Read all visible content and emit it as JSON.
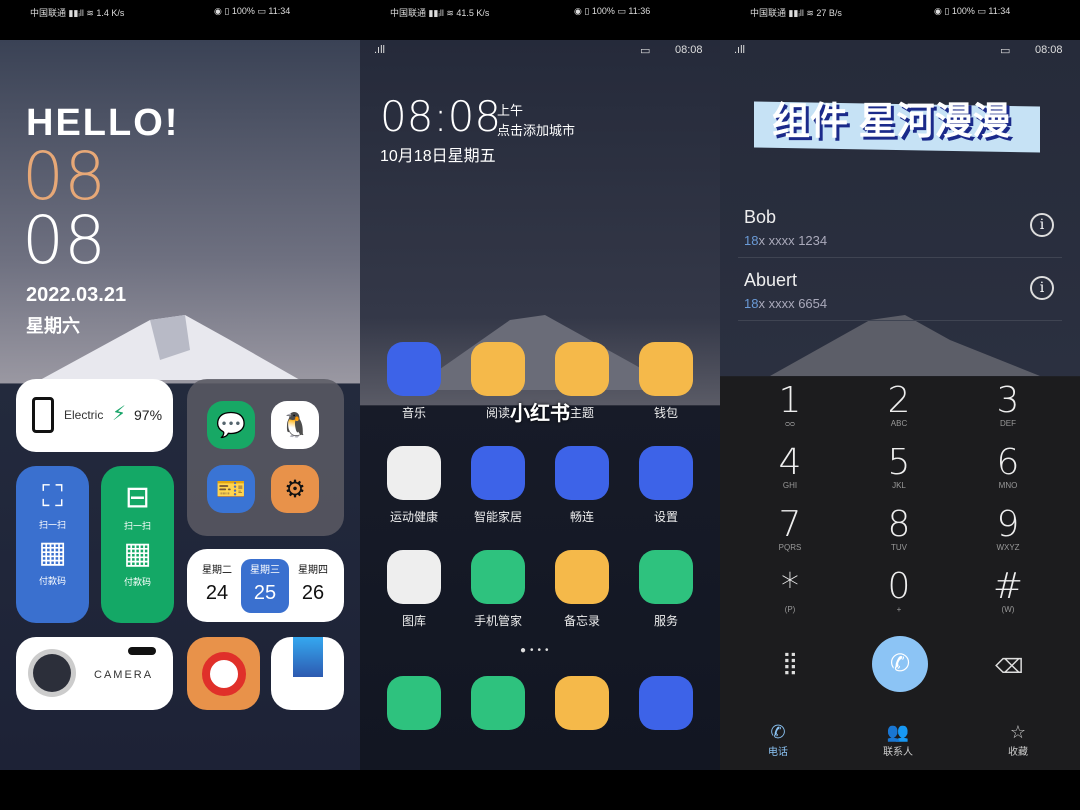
{
  "status_bars": [
    {
      "carrier": "中国联通",
      "speed": "1.4 K/s",
      "battery": "100%",
      "time": "11:34"
    },
    {
      "carrier": "中国联通",
      "speed": "41.5 K/s",
      "battery": "100%",
      "time": "11:36"
    },
    {
      "carrier": "中国联通",
      "speed": "27 B/s",
      "battery": "100%",
      "time": "11:34"
    }
  ],
  "left": {
    "hello": "HELLO!",
    "hour": "08",
    "minute": "08",
    "date": "2022.03.21",
    "weekday": "星期六",
    "battery_widget": {
      "label": "Electric",
      "percent": "97%",
      "level": 97
    },
    "scan_blue": {
      "scan": "扫一扫",
      "pay": "付款码"
    },
    "scan_green": {
      "scan": "扫一扫",
      "pay": "付款码"
    },
    "calendar": [
      {
        "day": "星期二",
        "num": "24"
      },
      {
        "day": "星期三",
        "num": "25"
      },
      {
        "day": "星期四",
        "num": "26"
      }
    ],
    "camera_label": "CAMERA"
  },
  "middle": {
    "phone_time": "08:08",
    "clock": "08:08",
    "ampm": "上午",
    "city_hint": "点击添加城市",
    "date": "10月18日星期五",
    "watermark": "小红书",
    "apps": [
      {
        "label": "音乐",
        "icon": "piano-icon",
        "color": "#3d63e8"
      },
      {
        "label": "阅读",
        "icon": "books-icon",
        "color": "#f5b94a"
      },
      {
        "label": "主题",
        "icon": "paintbrush-icon",
        "color": "#f5b94a"
      },
      {
        "label": "钱包",
        "icon": "wallet-icon",
        "color": "#f5b94a"
      },
      {
        "label": "运动健康",
        "icon": "heart-icon",
        "color": "#eeeeee"
      },
      {
        "label": "智能家居",
        "icon": "speaker-icon",
        "color": "#3d63e8"
      },
      {
        "label": "畅连",
        "icon": "webcam-icon",
        "color": "#3d63e8"
      },
      {
        "label": "设置",
        "icon": "gear-icon",
        "color": "#3d63e8"
      },
      {
        "label": "图库",
        "icon": "gallery-icon",
        "color": "#eeeeee"
      },
      {
        "label": "手机管家",
        "icon": "shield-icon",
        "color": "#2ec27e"
      },
      {
        "label": "备忘录",
        "icon": "notes-icon",
        "color": "#f5b94a"
      },
      {
        "label": "服务",
        "icon": "service-icon",
        "color": "#2ec27e"
      }
    ],
    "dock": [
      {
        "icon": "phone-icon",
        "color": "#2ec27e"
      },
      {
        "icon": "message-icon",
        "color": "#2ec27e"
      },
      {
        "icon": "browser-icon",
        "color": "#f5b94a"
      },
      {
        "icon": "camera-icon",
        "color": "#3d63e8"
      }
    ]
  },
  "right": {
    "phone_time": "08:08",
    "banner": "组件 星河漫漫",
    "contacts": [
      {
        "name": "Bob",
        "prefix": "18",
        "number": "x xxxx 1234"
      },
      {
        "name": "Abuert",
        "prefix": "18",
        "number": "x xxxx 6654"
      }
    ],
    "keys": [
      {
        "d": "1",
        "s": "ᴑᴑ"
      },
      {
        "d": "2",
        "s": "ABC"
      },
      {
        "d": "3",
        "s": "DEF"
      },
      {
        "d": "4",
        "s": "GHI"
      },
      {
        "d": "5",
        "s": "JKL"
      },
      {
        "d": "6",
        "s": "MNO"
      },
      {
        "d": "7",
        "s": "PQRS"
      },
      {
        "d": "8",
        "s": "TUV"
      },
      {
        "d": "9",
        "s": "WXYZ"
      },
      {
        "d": "*",
        "s": "(P)"
      },
      {
        "d": "0",
        "s": "+"
      },
      {
        "d": "#",
        "s": "(W)"
      }
    ],
    "tabs": [
      {
        "label": "电话",
        "active": true
      },
      {
        "label": "联系人"
      },
      {
        "label": "收藏"
      }
    ],
    "accent": "#8cc4f5"
  }
}
